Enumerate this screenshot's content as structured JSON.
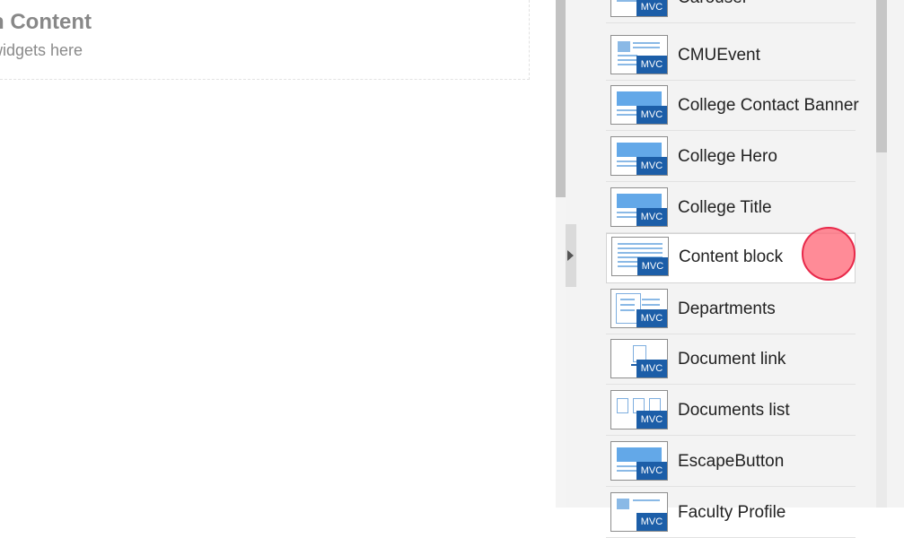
{
  "canvas": {
    "placeholder_title": "n Content",
    "placeholder_subtitle": "widgets here"
  },
  "toolbox": {
    "widgets": [
      {
        "label": "Carousel",
        "badge": "MVC",
        "icon": "carousel-icon"
      },
      {
        "label": "CMUEvent",
        "badge": "MVC",
        "icon": "event-icon"
      },
      {
        "label": "College Contact Banner",
        "badge": "MVC",
        "icon": "banner-icon"
      },
      {
        "label": "College Hero",
        "badge": "MVC",
        "icon": "hero-icon"
      },
      {
        "label": "College Title",
        "badge": "MVC",
        "icon": "title-icon"
      },
      {
        "label": "Content block",
        "badge": "MVC",
        "icon": "content-block-icon"
      },
      {
        "label": "Departments",
        "badge": "MVC",
        "icon": "list-icon"
      },
      {
        "label": "Document link",
        "badge": "MVC",
        "icon": "document-link-icon"
      },
      {
        "label": "Documents list",
        "badge": "MVC",
        "icon": "documents-list-icon"
      },
      {
        "label": "EscapeButton",
        "badge": "MVC",
        "icon": "button-icon"
      },
      {
        "label": "Faculty Profile",
        "badge": "MVC",
        "icon": "profile-icon"
      }
    ]
  },
  "colors": {
    "badge": "#1c5ea8",
    "icon_accent": "#63a8e8",
    "click_marker": "#ff6e7d"
  }
}
